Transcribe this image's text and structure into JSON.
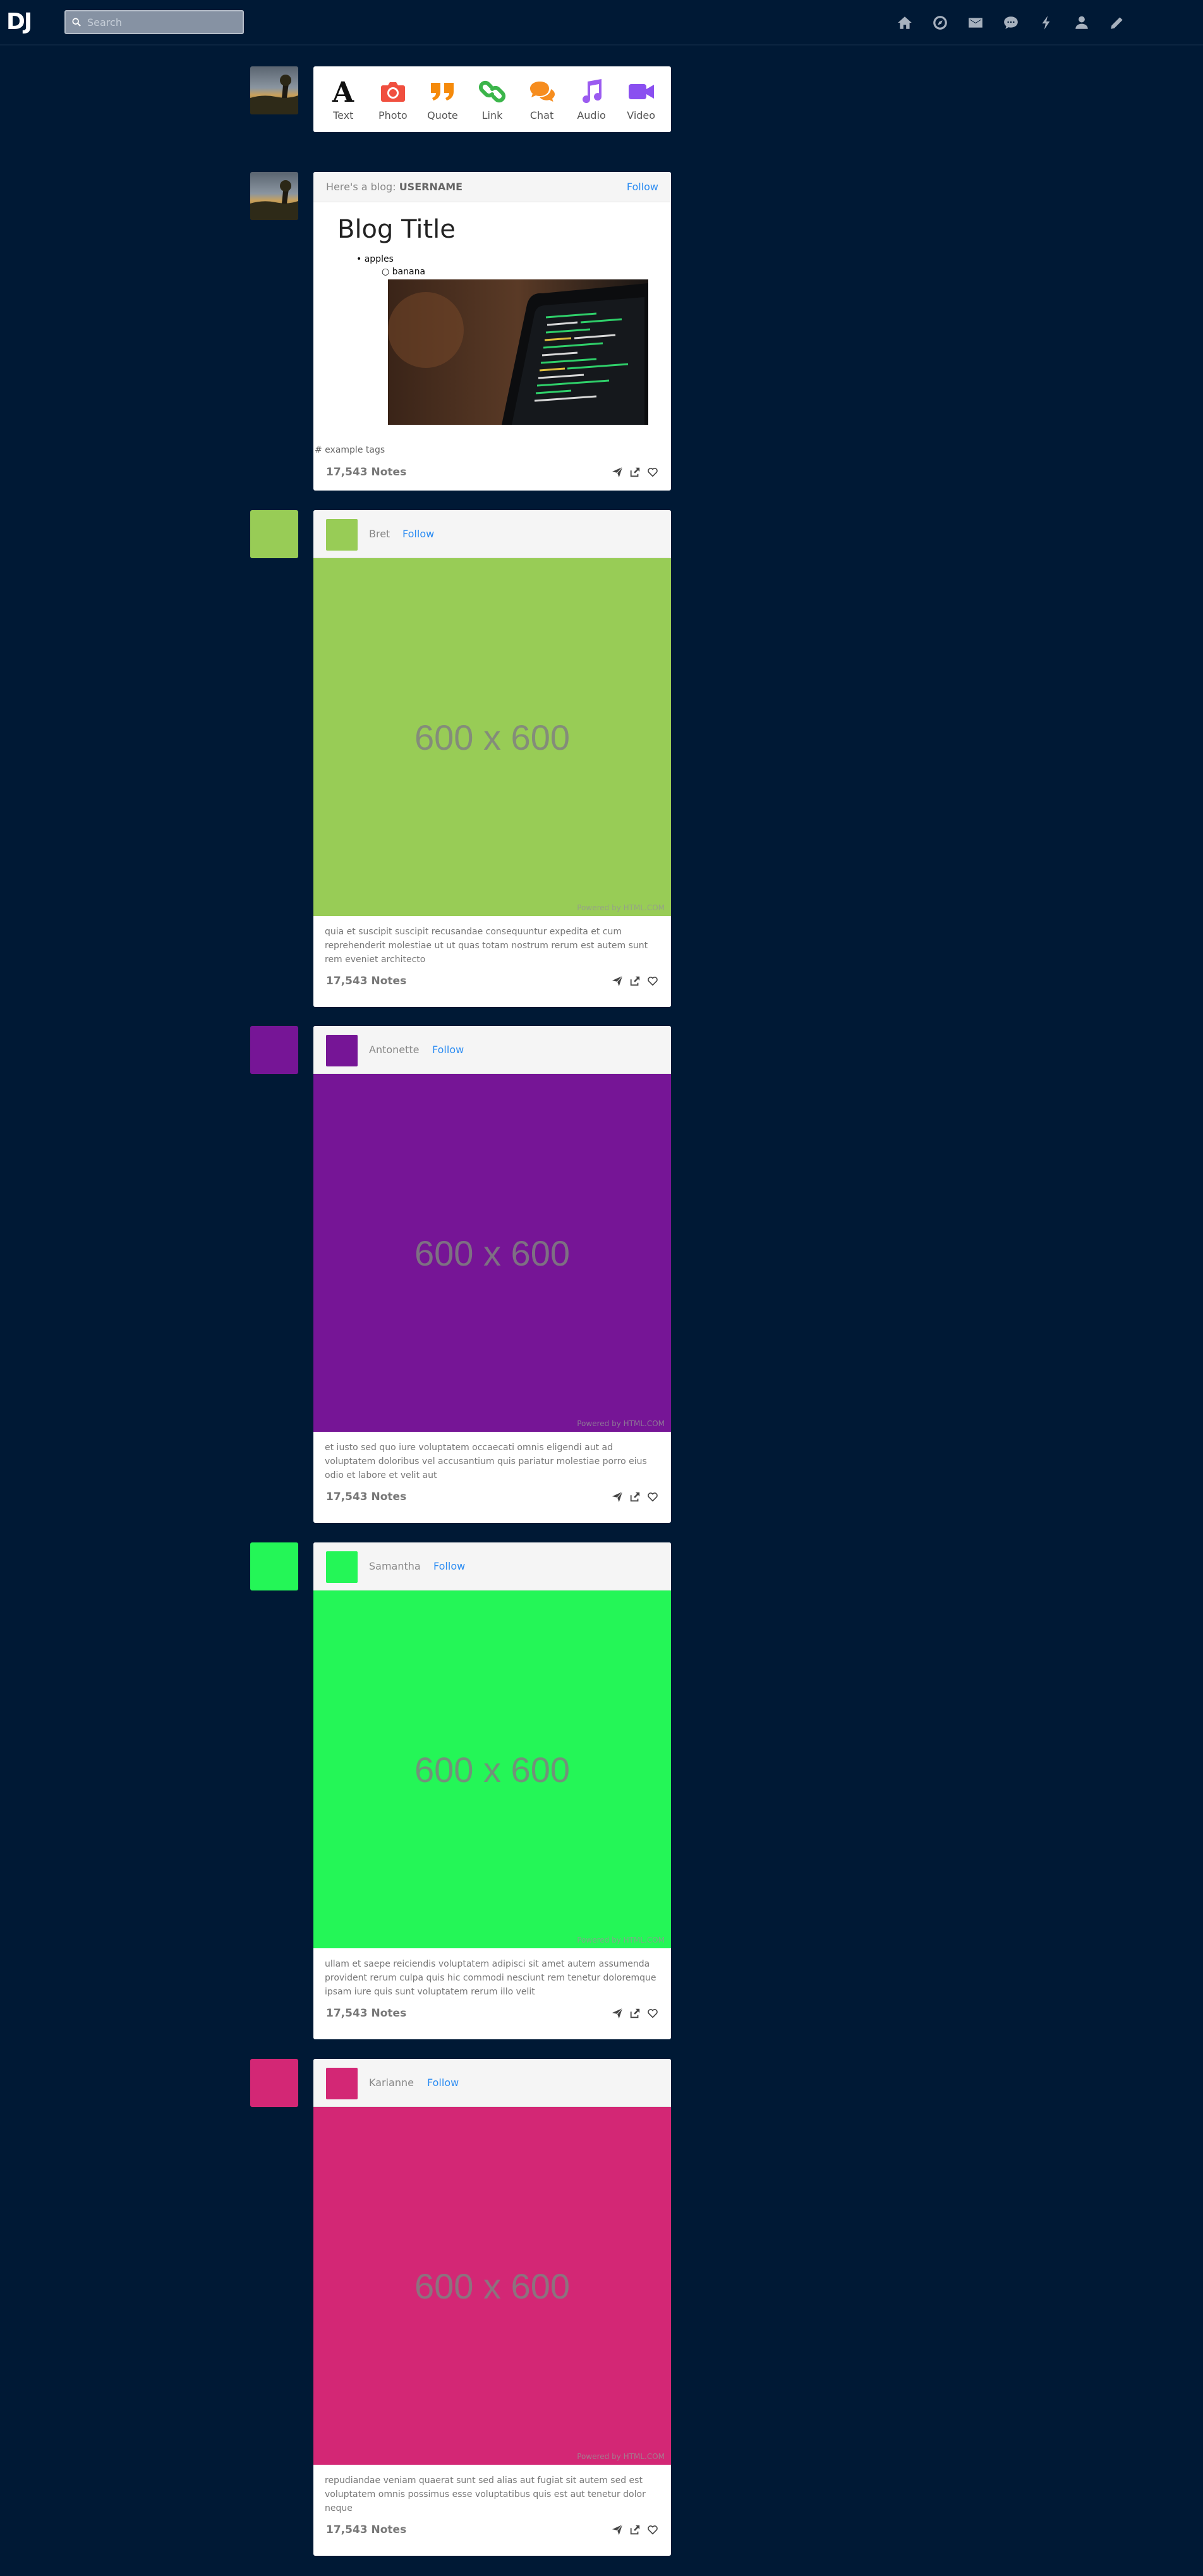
{
  "nav": {
    "logo": "DJ",
    "search_placeholder": "Search",
    "icons": [
      "home-icon",
      "compass-icon",
      "envelope-icon",
      "chat-icon",
      "lightning-icon",
      "user-icon",
      "pencil-icon"
    ]
  },
  "composer": {
    "options": [
      {
        "label": "Text",
        "color": "#111111",
        "icon": "text-icon"
      },
      {
        "label": "Photo",
        "color": "#f04f3f",
        "icon": "camera-icon"
      },
      {
        "label": "Quote",
        "color": "#f58a0b",
        "icon": "quote-icon"
      },
      {
        "label": "Link",
        "color": "#3bb54a",
        "icon": "link-icon"
      },
      {
        "label": "Chat",
        "color": "#f68d1f",
        "icon": "chat-icon"
      },
      {
        "label": "Audio",
        "color": "#9b5bf0",
        "icon": "music-icon"
      },
      {
        "label": "Video",
        "color": "#8a4ff0",
        "icon": "video-icon"
      }
    ]
  },
  "blog_post": {
    "header_prefix": "Here's a blog: ",
    "username": "USERNAME",
    "follow": "Follow",
    "title": "Blog Title",
    "list": [
      "apples",
      "banana"
    ],
    "tags": "# example tags",
    "notes": "17,543 Notes"
  },
  "posts": [
    {
      "name": "Bret",
      "follow": "Follow",
      "color": "#98cc56",
      "image_text": "600 x 600",
      "powered": "Powered by HTML.COM",
      "caption": "quia et suscipit suscipit recusandae consequuntur expedita et cum reprehenderit molestiae ut ut quas totam nostrum rerum est autem sunt rem eveniet architecto",
      "notes": "17,543 Notes"
    },
    {
      "name": "Antonette",
      "follow": "Follow",
      "color": "#761596",
      "image_text": "600 x 600",
      "powered": "Powered by HTML.COM",
      "caption": "et iusto sed quo iure voluptatem occaecati omnis eligendi aut ad voluptatem doloribus vel accusantium quis pariatur molestiae porro eius odio et labore et velit aut",
      "notes": "17,543 Notes"
    },
    {
      "name": "Samantha",
      "follow": "Follow",
      "color": "#24f657",
      "image_text": "600 x 600",
      "powered": "Powered by HTML.COM",
      "caption": "ullam et saepe reiciendis voluptatem adipisci sit amet autem assumenda provident rerum culpa quis hic commodi nesciunt rem tenetur doloremque ipsam iure quis sunt voluptatem rerum illo velit",
      "notes": "17,543 Notes"
    },
    {
      "name": "Karianne",
      "follow": "Follow",
      "color": "#d32775",
      "image_text": "600 x 600",
      "powered": "Powered by HTML.COM",
      "caption": "repudiandae veniam quaerat sunt sed alias aut fugiat sit autem sed est voluptatem omnis possimus esse voluptatibus quis est aut tenetur dolor neque",
      "notes": "17,543 Notes"
    }
  ]
}
